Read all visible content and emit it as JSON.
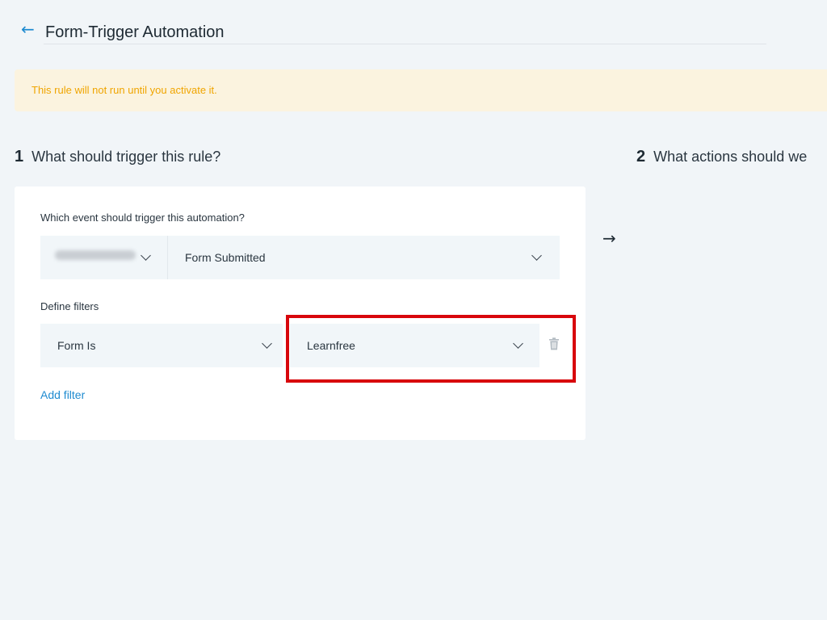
{
  "header": {
    "back_icon": "arrow-left-icon",
    "title": "Form-Trigger Automation"
  },
  "banner": {
    "text": "This rule will not run until you activate it.",
    "color": "#f0a500",
    "background": "#fbf3df"
  },
  "steps": [
    {
      "number": "1",
      "label": "What should trigger this rule?"
    },
    {
      "number": "2",
      "label": "What actions should we"
    }
  ],
  "trigger_card": {
    "event_label": "Which event should trigger this automation?",
    "app_select_value_obscured": true,
    "event_select_value": "Form Submitted",
    "filters_label": "Define filters",
    "filters": [
      {
        "field_value": "Form Is",
        "value": "Learnfree",
        "delete_icon": "trash-icon"
      }
    ],
    "add_filter_label": "Add filter"
  },
  "colors": {
    "accent": "#1f8bd0",
    "highlight": "#d8070c",
    "background": "#f1f5f8"
  }
}
